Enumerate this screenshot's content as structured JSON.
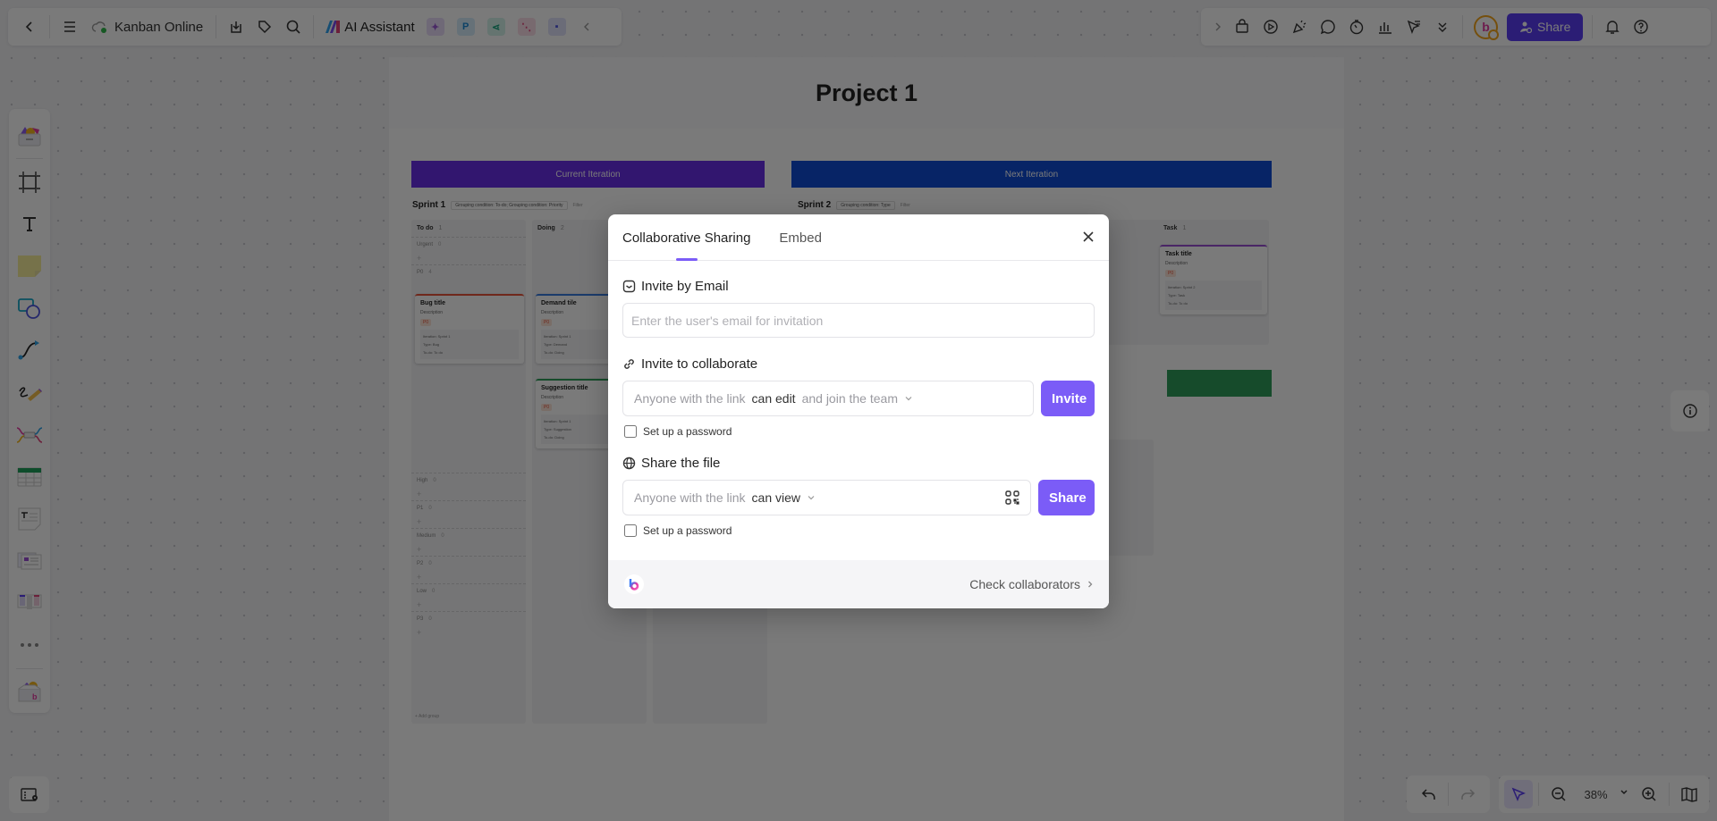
{
  "topbar": {
    "doc_title": "Kanban Online",
    "ai_assistant_label": "AI Assistant",
    "share_label": "Share",
    "app_icons": [
      {
        "name": "image-app-icon",
        "glyph": "✦",
        "bg": "#e8dcf9",
        "fg": "#9b59d6"
      },
      {
        "name": "p-app-icon",
        "glyph": "P",
        "bg": "#d6ecfb",
        "fg": "#1a88d6"
      },
      {
        "name": "mindmap-app-icon",
        "glyph": "⋖",
        "bg": "#d4f2ea",
        "fg": "#13a37e"
      },
      {
        "name": "flow-app-icon",
        "glyph": "⋱",
        "bg": "#fbdde8",
        "fg": "#e0437a"
      },
      {
        "name": "chat-app-icon",
        "glyph": "▪",
        "bg": "#dfe1fb",
        "fg": "#4e55e0"
      }
    ]
  },
  "board": {
    "title": "Project 1",
    "current_iteration": "Current Iteration",
    "next_iteration": "Next Iteration",
    "sprint1": {
      "name": "Sprint 1",
      "grouping": "Grouping condition: To-do; Grouping condition: Priority",
      "filter": "Filter"
    },
    "sprint2": {
      "name": "Sprint 2",
      "grouping": "Grouping condition: Type",
      "filter": "Filter"
    },
    "columns": [
      {
        "title": "To do",
        "count": "1"
      },
      {
        "title": "Doing",
        "count": "2"
      }
    ],
    "task_column": {
      "title": "Task",
      "count": "1"
    },
    "groups": [
      {
        "label": "Urgent",
        "count": "0"
      },
      {
        "label": "P0",
        "count": "4"
      },
      {
        "label": "High",
        "count": "0"
      },
      {
        "label": "P1",
        "count": "0"
      },
      {
        "label": "Medium",
        "count": "0"
      },
      {
        "label": "P2",
        "count": "0"
      },
      {
        "label": "Low",
        "count": "0"
      },
      {
        "label": "P3",
        "count": "0"
      }
    ],
    "add_group": "+ Add group",
    "cards": [
      {
        "title": "Bug title",
        "desc": "Description",
        "tag": "P0",
        "meta": [
          "Iteration: Sprint 1",
          "Type: Bug",
          "To-do: To do"
        ],
        "accent": "#e8553b"
      },
      {
        "title": "Demand tile",
        "desc": "Description",
        "tag": "P0",
        "meta": [
          "Iteration: Sprint 1",
          "Type: Demand",
          "To-do: Doing"
        ],
        "accent": "#3a7be0"
      },
      {
        "title": "Suggestion title",
        "desc": "Description",
        "tag": "P0",
        "meta": [
          "Iteration: Sprint 1",
          "Type: Suggestion",
          "To-do: Doing"
        ],
        "accent": "#2e9e5b"
      },
      {
        "title": "Task title",
        "desc": "Description",
        "tag": "P0",
        "meta": [
          "Iteration: Sprint 2",
          "Type: Task",
          "To-do: To do"
        ],
        "accent": "#9b4fd6"
      }
    ]
  },
  "dialog": {
    "tabs": [
      {
        "label": "Collaborative Sharing",
        "active": true
      },
      {
        "label": "Embed",
        "active": false
      }
    ],
    "invite_email": {
      "title": "Invite by Email",
      "placeholder": "Enter the user's email for invitation",
      "value": ""
    },
    "invite_collab": {
      "title": "Invite to collaborate",
      "prefix": "Anyone with the link",
      "permission": "can edit",
      "suffix": "and join the team",
      "button": "Invite",
      "password_label": "Set up a password",
      "password_checked": false
    },
    "share_file": {
      "title": "Share the file",
      "prefix": "Anyone with the link",
      "permission": "can view",
      "button": "Share",
      "password_label": "Set up a password",
      "password_checked": false
    },
    "footer": {
      "check_collaborators": "Check collaborators"
    }
  },
  "bottombar": {
    "zoom_level": "38%"
  },
  "colors": {
    "accent": "#7b5cf7",
    "share_top": "#5b3df5",
    "current_iteration": "#6a2ee8",
    "next_iteration": "#0f4bd6",
    "green_iteration": "#2e9e5b"
  }
}
